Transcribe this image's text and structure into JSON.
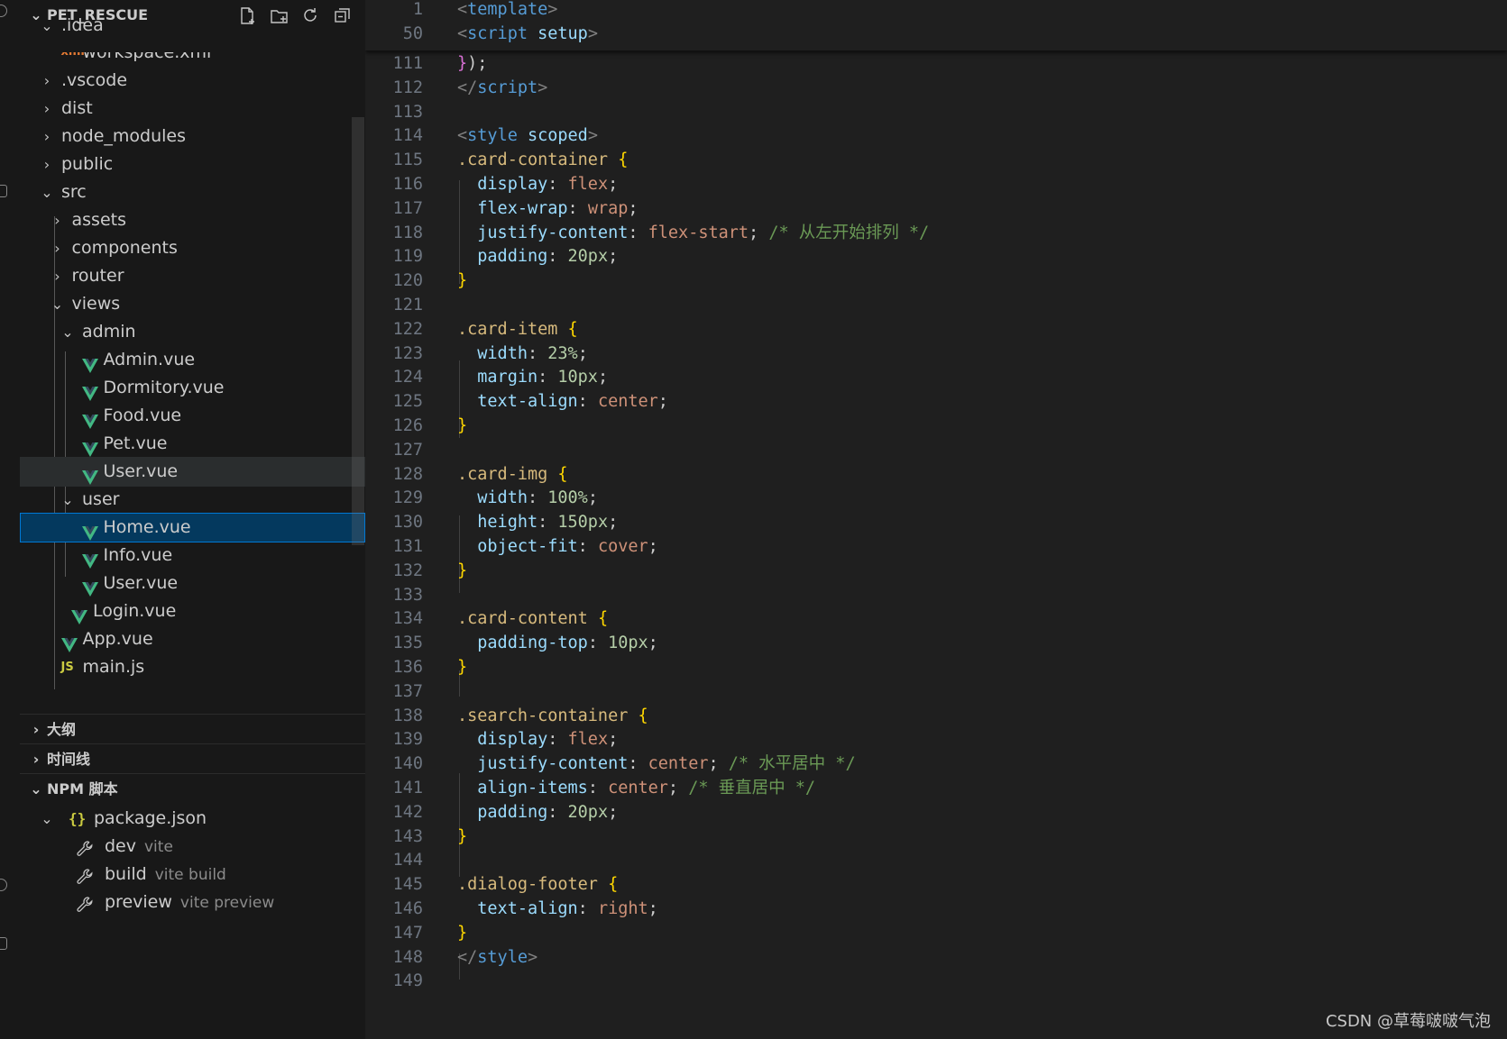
{
  "explorer": {
    "project_name": "PET_RESCUE",
    "tree": [
      {
        "label": ".idea",
        "expanded": true
      },
      {
        "label": "workspace.xml"
      },
      {
        "label": ".vscode",
        "expanded": false
      },
      {
        "label": "dist",
        "expanded": false
      },
      {
        "label": "node_modules",
        "expanded": false
      },
      {
        "label": "public",
        "expanded": false
      },
      {
        "label": "src",
        "expanded": true
      },
      {
        "label": "assets",
        "expanded": false
      },
      {
        "label": "components",
        "expanded": false
      },
      {
        "label": "router",
        "expanded": false
      },
      {
        "label": "views",
        "expanded": true
      },
      {
        "label": "admin",
        "expanded": true
      },
      {
        "label": "Admin.vue"
      },
      {
        "label": "Dormitory.vue"
      },
      {
        "label": "Food.vue"
      },
      {
        "label": "Pet.vue"
      },
      {
        "label": "User.vue"
      },
      {
        "label": "user",
        "expanded": true
      },
      {
        "label": "Home.vue",
        "selected": true
      },
      {
        "label": "Info.vue"
      },
      {
        "label": "User.vue"
      },
      {
        "label": "Login.vue"
      },
      {
        "label": "App.vue"
      },
      {
        "label": "main.js"
      }
    ]
  },
  "sections": {
    "outline": "大纲",
    "timeline": "时间线",
    "npm_scripts": "NPM 脚本"
  },
  "npm": {
    "package": "package.json",
    "scripts": [
      {
        "name": "dev",
        "command": "vite"
      },
      {
        "name": "build",
        "command": "vite build"
      },
      {
        "name": "preview",
        "command": "vite preview"
      }
    ]
  },
  "editor": {
    "sticky": [
      {
        "ln": "1",
        "tokens": [
          [
            "t-punct-tag",
            "<"
          ],
          [
            "t-tag",
            "template"
          ],
          [
            "t-punct-tag",
            ">"
          ]
        ]
      },
      {
        "ln": "50",
        "tokens": [
          [
            "t-punct-tag",
            "<"
          ],
          [
            "t-tag",
            "script"
          ],
          [
            "t-plain",
            " "
          ],
          [
            "t-keyattr",
            "setup"
          ],
          [
            "t-punct-tag",
            ">"
          ]
        ]
      }
    ],
    "lines": [
      {
        "ln": "111",
        "tokens": [
          [
            "t-paren",
            "}"
          ],
          [
            "t-plain",
            ");"
          ]
        ]
      },
      {
        "ln": "112",
        "tokens": [
          [
            "t-punct-tag",
            "</"
          ],
          [
            "t-tag",
            "script"
          ],
          [
            "t-punct-tag",
            ">"
          ]
        ]
      },
      {
        "ln": "113",
        "tokens": []
      },
      {
        "ln": "114",
        "tokens": [
          [
            "t-punct-tag",
            "<"
          ],
          [
            "t-tag",
            "style"
          ],
          [
            "t-plain",
            " "
          ],
          [
            "t-keyattr",
            "scoped"
          ],
          [
            "t-punct-tag",
            ">"
          ]
        ]
      },
      {
        "ln": "115",
        "tokens": [
          [
            "t-sel",
            ".card-container"
          ],
          [
            "t-plain",
            " "
          ],
          [
            "t-brace",
            "{"
          ]
        ]
      },
      {
        "ln": "116",
        "tokens": [
          [
            "t-plain",
            "  "
          ],
          [
            "t-prop",
            "display"
          ],
          [
            "t-plain",
            ": "
          ],
          [
            "t-val",
            "flex"
          ],
          [
            "t-plain",
            ";"
          ]
        ]
      },
      {
        "ln": "117",
        "tokens": [
          [
            "t-plain",
            "  "
          ],
          [
            "t-prop",
            "flex-wrap"
          ],
          [
            "t-plain",
            ": "
          ],
          [
            "t-val",
            "wrap"
          ],
          [
            "t-plain",
            ";"
          ]
        ]
      },
      {
        "ln": "118",
        "tokens": [
          [
            "t-plain",
            "  "
          ],
          [
            "t-prop",
            "justify-content"
          ],
          [
            "t-plain",
            ": "
          ],
          [
            "t-val",
            "flex-start"
          ],
          [
            "t-plain",
            "; "
          ],
          [
            "t-cmt",
            "/* 从左开始排列 */"
          ]
        ]
      },
      {
        "ln": "119",
        "tokens": [
          [
            "t-plain",
            "  "
          ],
          [
            "t-prop",
            "padding"
          ],
          [
            "t-plain",
            ": "
          ],
          [
            "t-num",
            "20px"
          ],
          [
            "t-plain",
            ";"
          ]
        ]
      },
      {
        "ln": "120",
        "tokens": [
          [
            "t-brace",
            "}"
          ]
        ]
      },
      {
        "ln": "121",
        "tokens": []
      },
      {
        "ln": "122",
        "tokens": [
          [
            "t-sel",
            ".card-item"
          ],
          [
            "t-plain",
            " "
          ],
          [
            "t-brace",
            "{"
          ]
        ]
      },
      {
        "ln": "123",
        "tokens": [
          [
            "t-plain",
            "  "
          ],
          [
            "t-prop",
            "width"
          ],
          [
            "t-plain",
            ": "
          ],
          [
            "t-num",
            "23%"
          ],
          [
            "t-plain",
            ";"
          ]
        ]
      },
      {
        "ln": "124",
        "tokens": [
          [
            "t-plain",
            "  "
          ],
          [
            "t-prop",
            "margin"
          ],
          [
            "t-plain",
            ": "
          ],
          [
            "t-num",
            "10px"
          ],
          [
            "t-plain",
            ";"
          ]
        ]
      },
      {
        "ln": "125",
        "tokens": [
          [
            "t-plain",
            "  "
          ],
          [
            "t-prop",
            "text-align"
          ],
          [
            "t-plain",
            ": "
          ],
          [
            "t-val",
            "center"
          ],
          [
            "t-plain",
            ";"
          ]
        ]
      },
      {
        "ln": "126",
        "tokens": [
          [
            "t-brace",
            "}"
          ]
        ]
      },
      {
        "ln": "127",
        "tokens": []
      },
      {
        "ln": "128",
        "tokens": [
          [
            "t-sel",
            ".card-img"
          ],
          [
            "t-plain",
            " "
          ],
          [
            "t-brace",
            "{"
          ]
        ]
      },
      {
        "ln": "129",
        "tokens": [
          [
            "t-plain",
            "  "
          ],
          [
            "t-prop",
            "width"
          ],
          [
            "t-plain",
            ": "
          ],
          [
            "t-num",
            "100%"
          ],
          [
            "t-plain",
            ";"
          ]
        ]
      },
      {
        "ln": "130",
        "tokens": [
          [
            "t-plain",
            "  "
          ],
          [
            "t-prop",
            "height"
          ],
          [
            "t-plain",
            ": "
          ],
          [
            "t-num",
            "150px"
          ],
          [
            "t-plain",
            ";"
          ]
        ]
      },
      {
        "ln": "131",
        "tokens": [
          [
            "t-plain",
            "  "
          ],
          [
            "t-prop",
            "object-fit"
          ],
          [
            "t-plain",
            ": "
          ],
          [
            "t-val",
            "cover"
          ],
          [
            "t-plain",
            ";"
          ]
        ]
      },
      {
        "ln": "132",
        "tokens": [
          [
            "t-brace",
            "}"
          ]
        ]
      },
      {
        "ln": "133",
        "tokens": []
      },
      {
        "ln": "134",
        "tokens": [
          [
            "t-sel",
            ".card-content"
          ],
          [
            "t-plain",
            " "
          ],
          [
            "t-brace",
            "{"
          ]
        ]
      },
      {
        "ln": "135",
        "tokens": [
          [
            "t-plain",
            "  "
          ],
          [
            "t-prop",
            "padding-top"
          ],
          [
            "t-plain",
            ": "
          ],
          [
            "t-num",
            "10px"
          ],
          [
            "t-plain",
            ";"
          ]
        ]
      },
      {
        "ln": "136",
        "tokens": [
          [
            "t-brace",
            "}"
          ]
        ]
      },
      {
        "ln": "137",
        "tokens": []
      },
      {
        "ln": "138",
        "tokens": [
          [
            "t-sel",
            ".search-container"
          ],
          [
            "t-plain",
            " "
          ],
          [
            "t-brace",
            "{"
          ]
        ]
      },
      {
        "ln": "139",
        "tokens": [
          [
            "t-plain",
            "  "
          ],
          [
            "t-prop",
            "display"
          ],
          [
            "t-plain",
            ": "
          ],
          [
            "t-val",
            "flex"
          ],
          [
            "t-plain",
            ";"
          ]
        ]
      },
      {
        "ln": "140",
        "tokens": [
          [
            "t-plain",
            "  "
          ],
          [
            "t-prop",
            "justify-content"
          ],
          [
            "t-plain",
            ": "
          ],
          [
            "t-val",
            "center"
          ],
          [
            "t-plain",
            "; "
          ],
          [
            "t-cmt",
            "/* 水平居中 */"
          ]
        ]
      },
      {
        "ln": "141",
        "tokens": [
          [
            "t-plain",
            "  "
          ],
          [
            "t-prop",
            "align-items"
          ],
          [
            "t-plain",
            ": "
          ],
          [
            "t-val",
            "center"
          ],
          [
            "t-plain",
            "; "
          ],
          [
            "t-cmt",
            "/* 垂直居中 */"
          ]
        ]
      },
      {
        "ln": "142",
        "tokens": [
          [
            "t-plain",
            "  "
          ],
          [
            "t-prop",
            "padding"
          ],
          [
            "t-plain",
            ": "
          ],
          [
            "t-num",
            "20px"
          ],
          [
            "t-plain",
            ";"
          ]
        ]
      },
      {
        "ln": "143",
        "tokens": [
          [
            "t-brace",
            "}"
          ]
        ]
      },
      {
        "ln": "144",
        "tokens": []
      },
      {
        "ln": "145",
        "tokens": [
          [
            "t-sel",
            ".dialog-footer"
          ],
          [
            "t-plain",
            " "
          ],
          [
            "t-brace",
            "{"
          ]
        ]
      },
      {
        "ln": "146",
        "tokens": [
          [
            "t-plain",
            "  "
          ],
          [
            "t-prop",
            "text-align"
          ],
          [
            "t-plain",
            ": "
          ],
          [
            "t-val",
            "right"
          ],
          [
            "t-plain",
            ";"
          ]
        ]
      },
      {
        "ln": "147",
        "tokens": [
          [
            "t-brace",
            "}"
          ]
        ]
      },
      {
        "ln": "148",
        "tokens": [
          [
            "t-punct-tag",
            "</"
          ],
          [
            "t-tag",
            "style"
          ],
          [
            "t-punct-tag",
            ">"
          ]
        ]
      },
      {
        "ln": "149",
        "tokens": []
      }
    ]
  },
  "watermark": "CSDN @草莓啵啵气泡",
  "colors": {
    "sidebar_bg": "#181818",
    "editor_bg": "#1f1f1f",
    "selection_bg": "#04395e",
    "vue_icon": "#42b883"
  }
}
